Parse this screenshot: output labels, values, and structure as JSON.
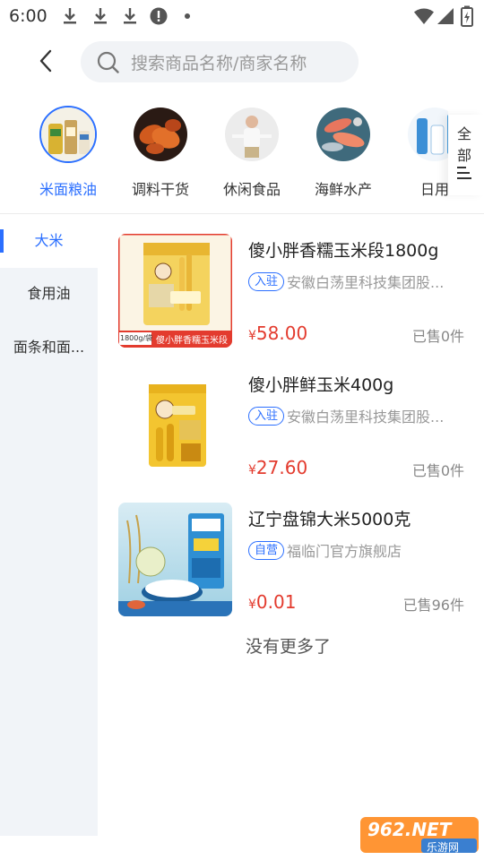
{
  "status_bar": {
    "time": "6:00",
    "icons": [
      "download-icon",
      "download-icon",
      "download-icon",
      "alert-icon",
      "dot-icon",
      "wifi-icon",
      "signal-icon",
      "battery-icon"
    ]
  },
  "header": {
    "back_icon": "chevron-left-icon",
    "search_placeholder": "搜索商品名称/商家名称"
  },
  "categories": [
    {
      "label": "米面粮油",
      "active": true
    },
    {
      "label": "调料干货",
      "active": false
    },
    {
      "label": "休闲食品",
      "active": false
    },
    {
      "label": "海鲜水产",
      "active": false
    },
    {
      "label": "日用",
      "active": false
    }
  ],
  "all_button": {
    "line1": "全",
    "line2": "部",
    "icon": "menu-icon"
  },
  "sidebar": [
    {
      "label": "大米",
      "active": true
    },
    {
      "label": "食用油",
      "active": false
    },
    {
      "label": "面条和面...",
      "active": false
    }
  ],
  "products": [
    {
      "name": "傻小胖香糯玉米段1800g",
      "tag": "入驻",
      "shop": "安徽白荡里科技集团股...",
      "currency": "¥",
      "price": "58.00",
      "sold": "已售0件",
      "image_caption": "傻小胖香糯玉米段",
      "image_weight": "1800g/袋"
    },
    {
      "name": "傻小胖鲜玉米400g",
      "tag": "入驻",
      "shop": "安徽白荡里科技集团股...",
      "currency": "¥",
      "price": "27.60",
      "sold": "已售0件"
    },
    {
      "name": "辽宁盘锦大米5000克",
      "tag": "自营",
      "shop": "福临门官方旗舰店",
      "currency": "¥",
      "price": "0.01",
      "sold": "已售96件"
    }
  ],
  "footer_text": "没有更多了",
  "watermark": {
    "main": "962.NET",
    "sub": "乐游网"
  },
  "colors": {
    "accent": "#2b6fff",
    "price": "#e33b2e",
    "sidebar_bg": "#f1f4f8",
    "search_bg": "#f1f3f6"
  }
}
